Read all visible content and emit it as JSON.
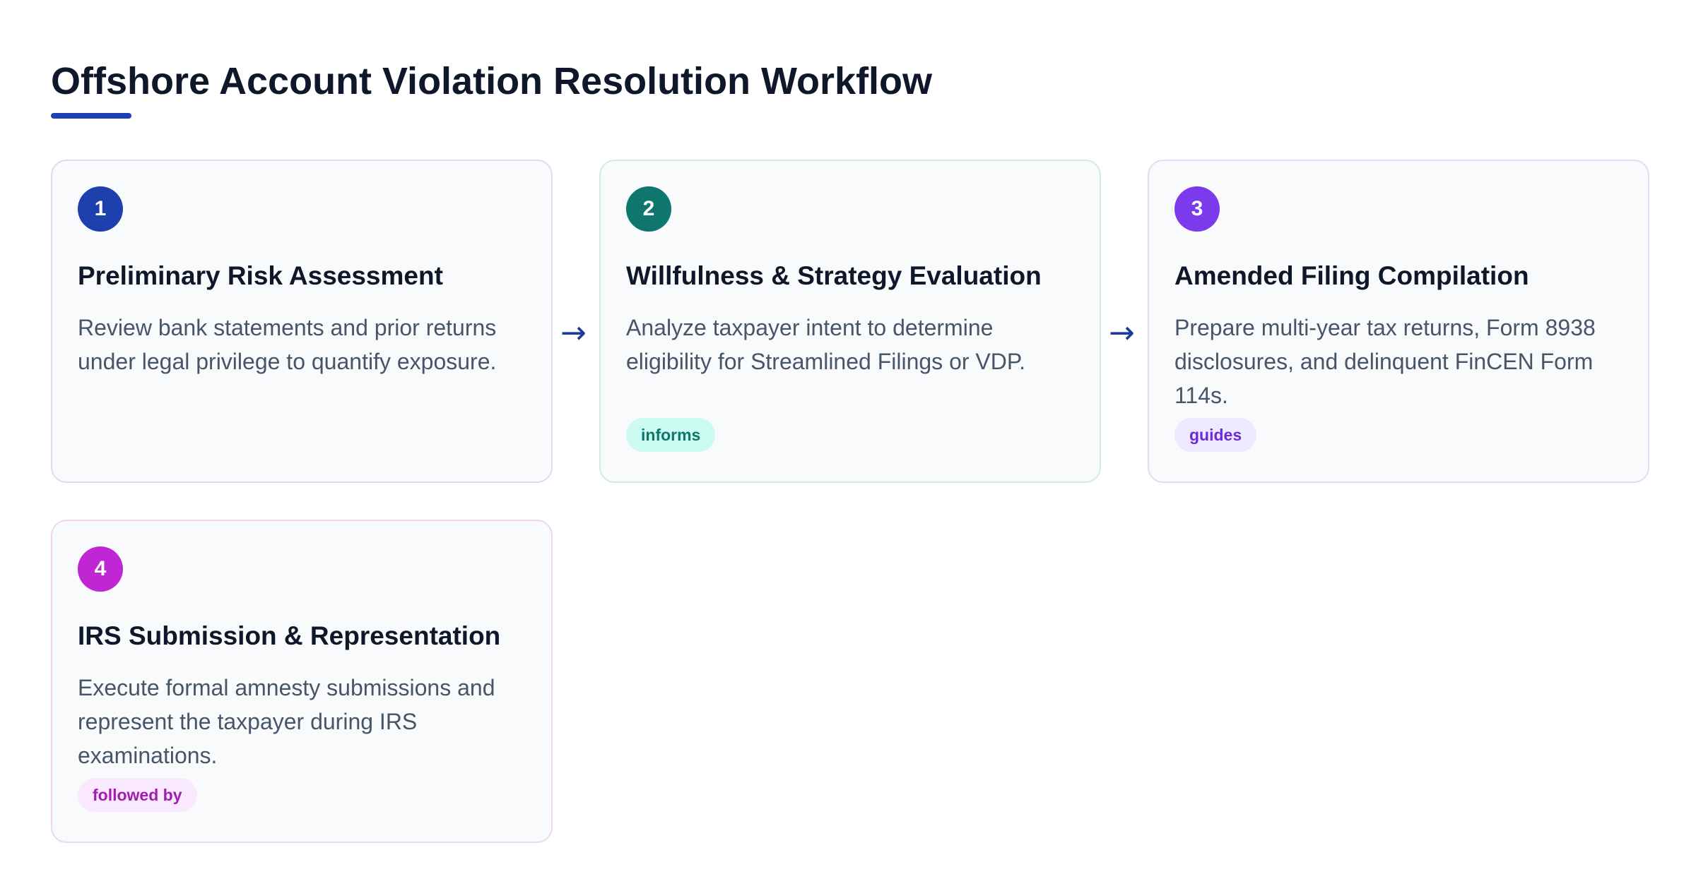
{
  "header": {
    "title": "Offshore Account Violation Resolution Workflow"
  },
  "colors": {
    "accent": "#1e40af",
    "step1": "#1e40af",
    "step2": "#0f766e",
    "step3": "#7c3aed",
    "step4": "#c026d3"
  },
  "arrow_glyph": "→",
  "steps": [
    {
      "number": "1",
      "title": "Preliminary Risk Assessment",
      "description": "Review bank statements and prior returns under legal privilege to quantify exposure.",
      "tag": ""
    },
    {
      "number": "2",
      "title": "Willfulness & Strategy Evaluation",
      "description": "Analyze taxpayer intent to determine eligibility for Streamlined Filings or VDP.",
      "tag": "informs"
    },
    {
      "number": "3",
      "title": "Amended Filing Compilation",
      "description": "Prepare multi-year tax returns, Form 8938 disclosures, and delinquent FinCEN Form 114s.",
      "tag": "guides"
    },
    {
      "number": "4",
      "title": "IRS Submission & Representation",
      "description": "Execute formal amnesty submissions and represent the taxpayer during IRS examinations.",
      "tag": "followed by"
    }
  ]
}
